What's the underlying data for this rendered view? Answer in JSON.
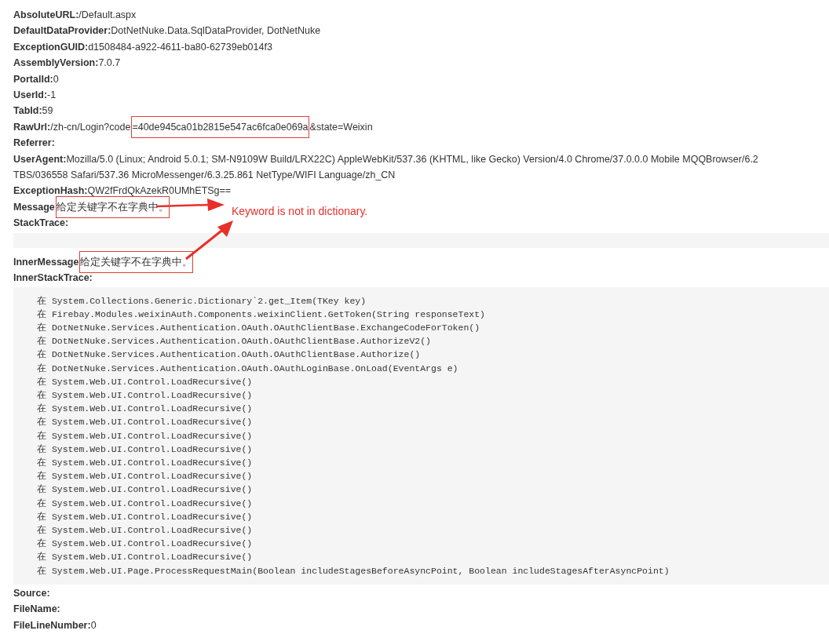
{
  "entries": [
    {
      "kind": "field",
      "label": "AbsoluteURL:",
      "parts": [
        {
          "text": "/Default.aspx",
          "boxed": false
        }
      ]
    },
    {
      "kind": "field",
      "label": "DefaultDataProvider:",
      "parts": [
        {
          "text": "DotNetNuke.Data.SqlDataProvider, DotNetNuke",
          "boxed": false
        }
      ]
    },
    {
      "kind": "field",
      "label": "ExceptionGUID:",
      "parts": [
        {
          "text": "d1508484-a922-4611-ba80-62739eb014f3",
          "boxed": false
        }
      ]
    },
    {
      "kind": "field",
      "label": "AssemblyVersion:",
      "parts": [
        {
          "text": "7.0.7",
          "boxed": false
        }
      ]
    },
    {
      "kind": "field",
      "label": "PortalId:",
      "parts": [
        {
          "text": "0",
          "boxed": false
        }
      ]
    },
    {
      "kind": "field",
      "label": "UserId:",
      "parts": [
        {
          "text": "-1",
          "boxed": false
        }
      ]
    },
    {
      "kind": "field",
      "label": "TabId:",
      "parts": [
        {
          "text": "59",
          "boxed": false
        }
      ]
    },
    {
      "kind": "field",
      "label": "RawUrl:",
      "parts": [
        {
          "text": "/zh-cn/Login?code",
          "boxed": false
        },
        {
          "text": "=40de945ca01b2815e547ac6fca0e069a",
          "boxed": true
        },
        {
          "text": "&state=Weixin",
          "boxed": false
        }
      ]
    },
    {
      "kind": "field",
      "label": "Referrer:"
    },
    {
      "kind": "field",
      "label": "UserAgent:",
      "parts": [
        {
          "text": "Mozilla/5.0 (Linux; Android 5.0.1; SM-N9109W Build/LRX22C) AppleWebKit/537.36 (KHTML, like Gecko) Version/4.0 Chrome/37.0.0.0 Mobile MQQBrowser/6.2 TBS/036558 Safari/537.36 MicroMessenger/6.3.25.861 NetType/WIFI Language/zh_CN",
          "boxed": false
        }
      ]
    },
    {
      "kind": "field",
      "label": "ExceptionHash:",
      "parts": [
        {
          "text": "QW2fFrdQkAzekR0UMhETSg==",
          "boxed": false
        }
      ]
    },
    {
      "kind": "field",
      "label": "Message",
      "parts": [
        {
          "text": "给定关键字不在字典中。",
          "boxed": true
        }
      ]
    },
    {
      "kind": "field",
      "label": "StackTrace:"
    },
    {
      "kind": "code"
    },
    {
      "kind": "field",
      "label": "InnerMessage",
      "parts": [
        {
          "text": "给定关键字不在字典中。",
          "boxed": true
        }
      ]
    },
    {
      "kind": "field",
      "label": "InnerStackTrace:"
    },
    {
      "kind": "code",
      "lines": [
        "在 System.Collections.Generic.Dictionary`2.get_Item(TKey key)",
        "在 Firebay.Modules.weixinAuth.Components.weixinClient.GetToken(String responseText)",
        "在 DotNetNuke.Services.Authentication.OAuth.OAuthClientBase.ExchangeCodeForToken()",
        "在 DotNetNuke.Services.Authentication.OAuth.OAuthClientBase.AuthorizeV2()",
        "在 DotNetNuke.Services.Authentication.OAuth.OAuthClientBase.Authorize()",
        "在 DotNetNuke.Services.Authentication.OAuth.OAuthLoginBase.OnLoad(EventArgs e)",
        "在 System.Web.UI.Control.LoadRecursive()",
        "在 System.Web.UI.Control.LoadRecursive()",
        "在 System.Web.UI.Control.LoadRecursive()",
        "在 System.Web.UI.Control.LoadRecursive()",
        "在 System.Web.UI.Control.LoadRecursive()",
        "在 System.Web.UI.Control.LoadRecursive()",
        "在 System.Web.UI.Control.LoadRecursive()",
        "在 System.Web.UI.Control.LoadRecursive()",
        "在 System.Web.UI.Control.LoadRecursive()",
        "在 System.Web.UI.Control.LoadRecursive()",
        "在 System.Web.UI.Control.LoadRecursive()",
        "在 System.Web.UI.Control.LoadRecursive()",
        "在 System.Web.UI.Control.LoadRecursive()",
        "在 System.Web.UI.Control.LoadRecursive()",
        "在 System.Web.UI.Page.ProcessRequestMain(Boolean includeStagesBeforeAsyncPoint, Boolean includeStagesAfterAsyncPoint)"
      ]
    },
    {
      "kind": "field",
      "label": "Source:"
    },
    {
      "kind": "field",
      "label": "FileName:"
    },
    {
      "kind": "field",
      "label": "FileLineNumber:",
      "parts": [
        {
          "text": "0",
          "boxed": false
        }
      ]
    }
  ],
  "annotation": {
    "text": "Keyword is not in dictionary."
  }
}
